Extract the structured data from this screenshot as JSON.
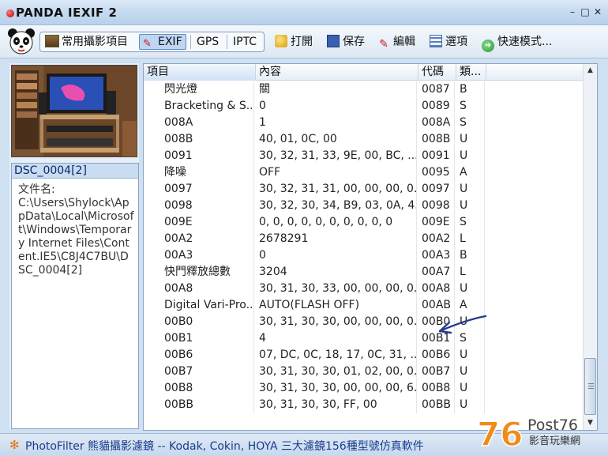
{
  "titlebar": {
    "title": "PANDA IEXIF 2",
    "minimize": "–",
    "restore": "□",
    "close": "✕"
  },
  "toolbar": {
    "tabs": [
      {
        "label": "常用攝影項目",
        "active": false
      },
      {
        "label": "EXIF",
        "active": true
      },
      {
        "label": "GPS",
        "active": false
      },
      {
        "label": "IPTC",
        "active": false
      }
    ],
    "open_label": "打開",
    "save_label": "保存",
    "edit_label": "編輯",
    "options_label": "選項",
    "quick_label": "快速模式..."
  },
  "left": {
    "file_title": "DSC_0004[2]",
    "name_label": "文件名:",
    "path": "C:\\Users\\Shylock\\AppData\\Local\\Microsoft\\Windows\\Temporary Internet Files\\Content.IE5\\C8J4C7BU\\DSC_0004[2]"
  },
  "table": {
    "headers": {
      "item": "項目",
      "content": "內容",
      "code": "代碼",
      "type": "類..."
    },
    "rows": [
      {
        "item": "閃光燈",
        "content": "關",
        "code": "0087",
        "type": "B"
      },
      {
        "item": "Bracketing & S...",
        "content": "0",
        "code": "0089",
        "type": "S"
      },
      {
        "item": "008A",
        "content": "1",
        "code": "008A",
        "type": "S"
      },
      {
        "item": "008B",
        "content": "40, 01, 0C, 00",
        "code": "008B",
        "type": "U"
      },
      {
        "item": "0091",
        "content": "30, 32, 31, 33, 9E, 00, BC, ...",
        "code": "0091",
        "type": "U"
      },
      {
        "item": "降噪",
        "content": "OFF",
        "code": "0095",
        "type": "A"
      },
      {
        "item": "0097",
        "content": "30, 32, 31, 31, 00, 00, 00, 0...",
        "code": "0097",
        "type": "U"
      },
      {
        "item": "0098",
        "content": "30, 32, 30, 34, B9, 03, 0A, 4...",
        "code": "0098",
        "type": "U"
      },
      {
        "item": "009E",
        "content": "0, 0, 0, 0, 0, 0, 0, 0, 0, 0",
        "code": "009E",
        "type": "S"
      },
      {
        "item": "00A2",
        "content": "2678291",
        "code": "00A2",
        "type": "L"
      },
      {
        "item": "00A3",
        "content": "0",
        "code": "00A3",
        "type": "B"
      },
      {
        "item": "快門釋放總數",
        "content": "3204",
        "code": "00A7",
        "type": "L"
      },
      {
        "item": "00A8",
        "content": "30, 31, 30, 33, 00, 00, 00, 0...",
        "code": "00A8",
        "type": "U"
      },
      {
        "item": "Digital Vari-Pro...",
        "content": "AUTO(FLASH OFF)",
        "code": "00AB",
        "type": "A"
      },
      {
        "item": "00B0",
        "content": "30, 31, 30, 30, 00, 00, 00, 0...",
        "code": "00B0",
        "type": "U"
      },
      {
        "item": "00B1",
        "content": "4",
        "code": "00B1",
        "type": "S"
      },
      {
        "item": "00B6",
        "content": "07, DC, 0C, 18, 17, 0C, 31, ...",
        "code": "00B6",
        "type": "U"
      },
      {
        "item": "00B7",
        "content": "30, 31, 30, 30, 01, 02, 00, 0...",
        "code": "00B7",
        "type": "U"
      },
      {
        "item": "00B8",
        "content": "30, 31, 30, 30, 00, 00, 00, 6...",
        "code": "00B8",
        "type": "U"
      },
      {
        "item": "00BB",
        "content": "30, 31, 30, 30, FF, 00",
        "code": "00BB",
        "type": "U"
      }
    ]
  },
  "statusbar": {
    "text": "PhotoFilter 熊貓攝影濾鏡 -- Kodak, Cokin, HOYA 三大濾鏡156種型號仿真軟件"
  },
  "watermark": {
    "big": "76",
    "small": "Post76",
    "sub": "影音玩樂網"
  },
  "colors": {
    "accent": "#1a3d8c",
    "selection": "#bfd6f2",
    "arrow": "#2a3a8c"
  }
}
